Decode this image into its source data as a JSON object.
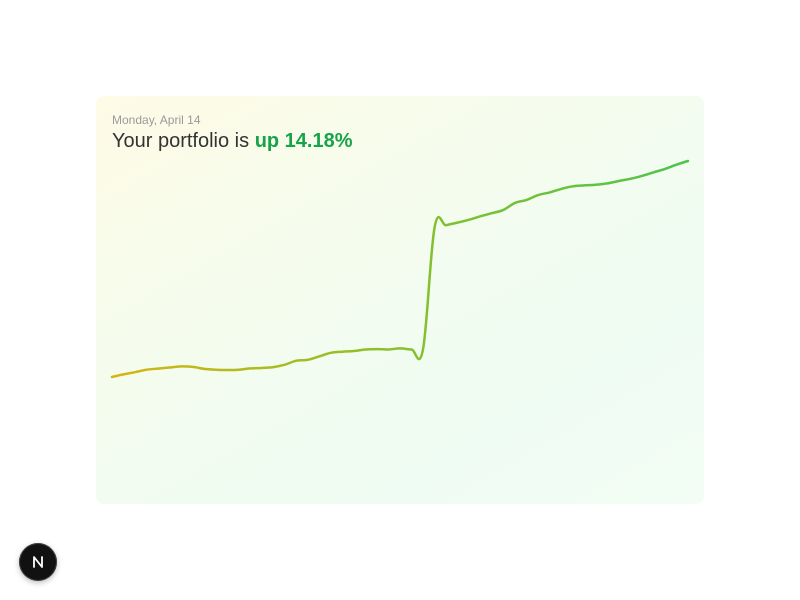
{
  "card": {
    "date": "Monday, April 14",
    "headline_prefix": "Your portfolio is",
    "headline_value": "up 14.18%"
  },
  "chart_data": {
    "type": "line",
    "title": "",
    "xlabel": "",
    "ylabel": "",
    "grid": false,
    "legend": "none",
    "ylim": [
      0,
      120
    ],
    "series": [
      {
        "values": [
          20.0,
          21.2,
          22.2,
          23.3,
          23.8,
          24.3,
          24.8,
          24.6,
          23.7,
          23.3,
          23.2,
          23.3,
          23.9,
          24.1,
          24.5,
          25.6,
          27.4,
          27.8,
          29.4,
          31.0,
          31.5,
          31.8,
          32.5,
          32.7,
          32.5,
          33.0,
          32.5,
          32.6,
          88.0,
          89.0,
          90.2,
          91.5,
          93.1,
          94.5,
          96.0,
          99.2,
          100.5,
          102.7,
          103.9,
          105.5,
          106.7,
          107.1,
          107.4,
          108.0,
          109.1,
          110.1,
          111.4,
          113.0,
          114.6,
          116.5,
          118.2
        ]
      }
    ],
    "colors": [
      "#d6b514",
      "#8fbf2a",
      "#4ec44a"
    ]
  },
  "badge": {
    "icon": "nextjs-logo-icon"
  }
}
